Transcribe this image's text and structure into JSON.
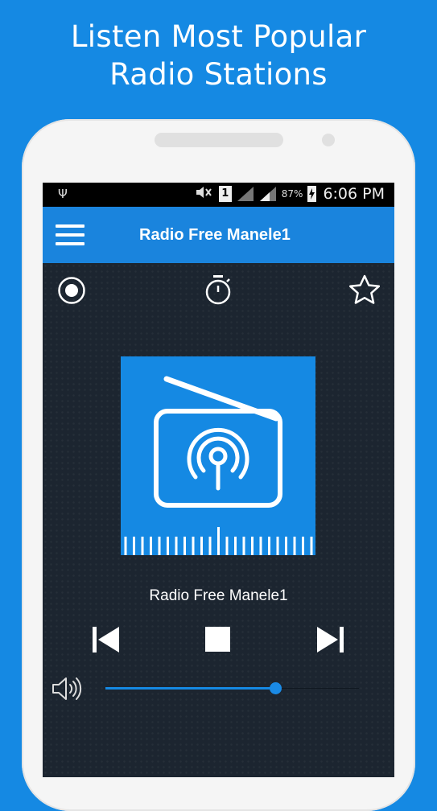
{
  "promo": {
    "line1": "Listen Most Popular",
    "line2": "Radio Stations"
  },
  "status_bar": {
    "sim_label": "1",
    "battery_percent": "87%",
    "time": "6:06 PM",
    "icons": [
      "usb-icon",
      "mute-icon",
      "sim-icon",
      "signal-icon",
      "battery-icon"
    ]
  },
  "app_bar": {
    "title": "Radio Free Manele1",
    "menu_icon": "hamburger-menu-icon"
  },
  "toolbar_icons": [
    "record-icon",
    "timer-icon",
    "favorite-star-icon"
  ],
  "player": {
    "station_name": "Radio Free Manele1",
    "controls": [
      "previous-icon",
      "stop-icon",
      "next-icon"
    ],
    "volume_level": 0.67,
    "accent_color": "#1589e3"
  }
}
